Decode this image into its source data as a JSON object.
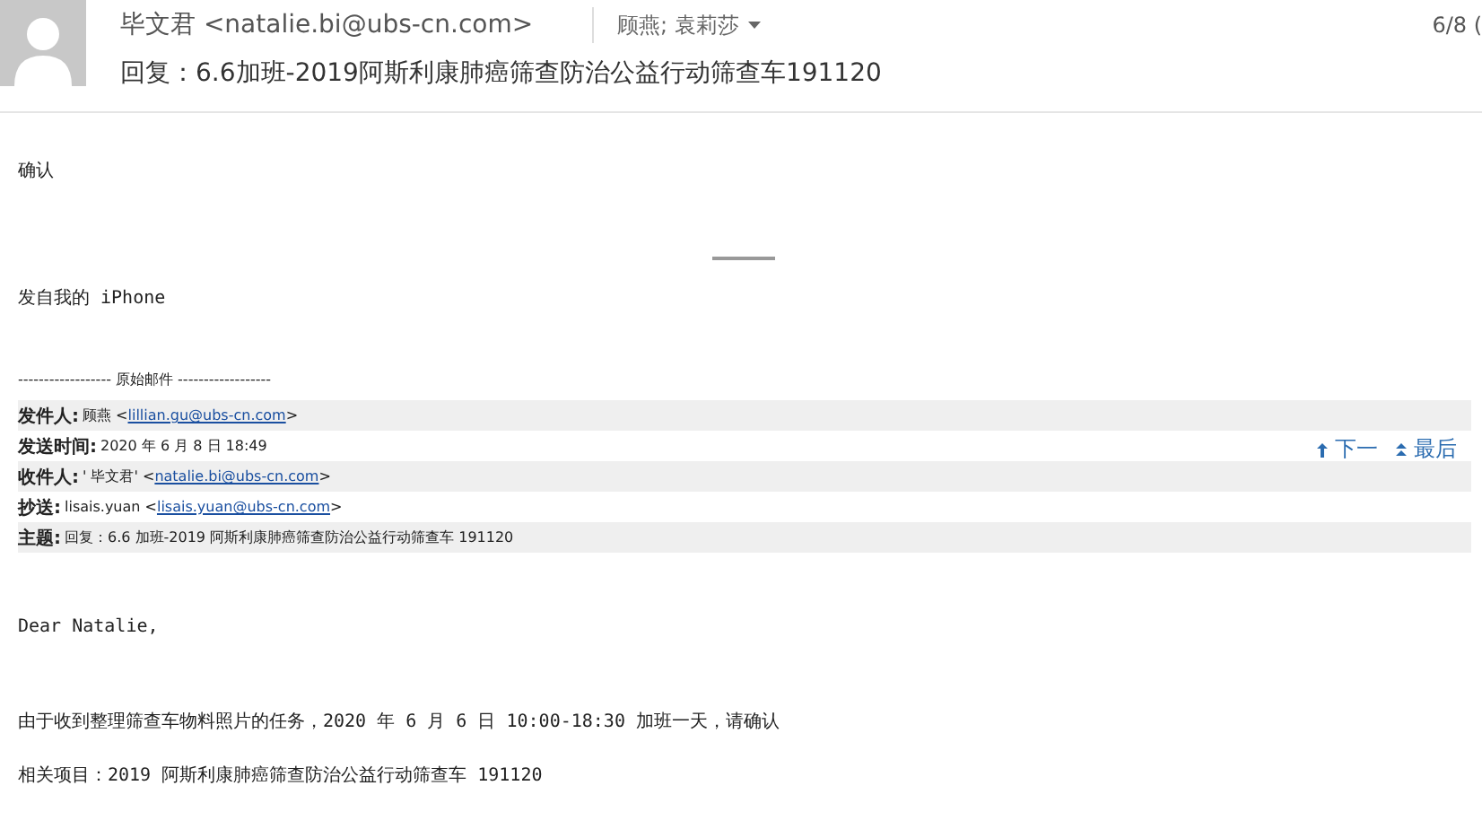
{
  "header": {
    "sender": "毕文君 <natalie.bi@ubs-cn.com>",
    "recipients": "顾燕; 袁莉莎",
    "subject": "回复：6.6加班-2019阿斯利康肺癌筛查防治公益行动筛查车191120",
    "date": "6/8 ("
  },
  "body_top": [
    {
      "text": "确认"
    }
  ],
  "signature": "发自我的 iPhone",
  "original_divider": "------------------ 原始邮件 ------------------",
  "original_fields": [
    {
      "label": "发件人:",
      "value": "顾燕 <",
      "link": "lillian.gu@ubs-cn.com",
      "after": ">"
    },
    {
      "label": "发送时间:",
      "value": "2020 年 6 月 8 日 18:49"
    },
    {
      "label": "收件人:",
      "value": "' 毕文君' <",
      "link": "natalie.bi@ubs-cn.com",
      "after": ">"
    },
    {
      "label": "抄送:",
      "value": "lisais.yuan <",
      "link": "lisais.yuan@ubs-cn.com",
      "after": ">"
    },
    {
      "label": "主题:",
      "value": "回复：6.6 加班-2019 阿斯利康肺癌筛查防治公益行动筛查车 191120"
    }
  ],
  "nav_links": [
    {
      "kind": "prev",
      "label": "下一"
    },
    {
      "kind": "last",
      "label": "最后"
    }
  ],
  "body": [
    "Dear Natalie,",
    "由于收到整理筛查车物料照片的任务，2020 年 6 月 6 日 10:00-18:30 加班一天，请确认",
    "相关项目：2019 阿斯利康肺癌筛查防治公益行动筛查车 191120"
  ]
}
